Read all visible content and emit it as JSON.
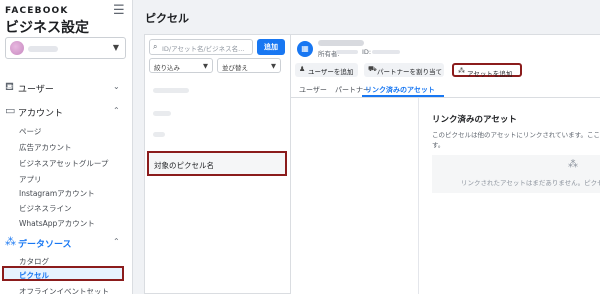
{
  "sidebar": {
    "brand": "FACEBOOK",
    "title": "ビジネス設定",
    "nav": {
      "users": "ユーザー",
      "accounts": "アカウント",
      "data_sources": "データソース"
    },
    "account_items": [
      "ページ",
      "広告アカウント",
      "ビジネスアセットグループ",
      "アプリ",
      "Instagramアカウント",
      "ビジネスライン",
      "WhatsAppアカウント"
    ],
    "data_source_items": [
      "カタログ",
      "ピクセル",
      "オフラインイベントセット"
    ]
  },
  "page": {
    "title": "ピクセル"
  },
  "list": {
    "search_placeholder": "ID/アセット名/ビジネス名...",
    "add_label": "追加",
    "filter_label": "絞り込み",
    "sort_label": "並び替え",
    "selected_pixel": "対象のピクセル名"
  },
  "detail": {
    "owner_label": "所有者:",
    "id_label": "ID:",
    "actions": {
      "add_user": "ユーザーを追加",
      "assign_partner": "パートナーを割り当て",
      "add_asset": "アセットを追加"
    },
    "tabs": [
      "ユーザー",
      "パートナー",
      "リンク済みのアセット"
    ],
    "linked_title": "リンク済みのアセット",
    "linked_desc": "このピクセルは他のアセットにリンクされています。ここか",
    "linked_desc_2": "す。",
    "empty_text": "リンクされたアセットはまだありません。ピクセ"
  },
  "colors": {
    "accent": "#1877f2",
    "highlight_border": "#8b1c1c"
  }
}
